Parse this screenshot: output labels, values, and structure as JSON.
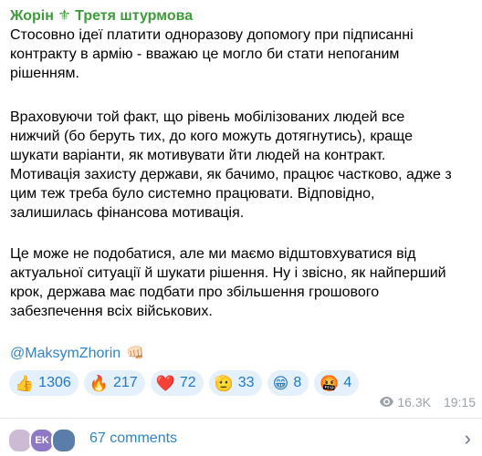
{
  "channel": {
    "name": "Жорін",
    "separator": "⚜",
    "subtitle": "Третя штурмова"
  },
  "post": {
    "paragraph1": "Стосовно ідеї платити одноразову допомогу при підписанні\nконтракту в армію - вважаю це могло би стати непоганим\nрішенням.",
    "paragraph2": "Враховуючи той факт, що рівень мобілізованих людей все\nнижчий (бо беруть тих, до кого можуть дотягнутись), краще\nшукати варіанти, як мотивувати йти людей на контракт.\nМотивація захисту держави, як бачимо, працює частково, адже з\nцим теж треба було системно працювати. Відповідно,\nзалишилась фінансова мотивація.",
    "paragraph3": "Це може не подобатися, але ми маємо відштовхуватися від\nактуальної ситуації й шукати рішення. Ну і звісно, як найперший\nкрок, держава має подбати про збільшення грошового\nзабезпечення всіх військових.",
    "mention": "@MaksymZhorin",
    "mention_emoji": "👊🏻"
  },
  "reactions": [
    {
      "emoji": "👍",
      "count": "1306"
    },
    {
      "emoji": "🔥",
      "count": "217"
    },
    {
      "emoji": "❤️",
      "count": "72"
    },
    {
      "emoji": "🫡",
      "count": "33"
    },
    {
      "emoji": "😁",
      "count": "8"
    },
    {
      "emoji": "🤬",
      "count": "4"
    }
  ],
  "meta": {
    "views": "16.3K",
    "time": "19:15"
  },
  "comments": {
    "avatar2_initials": "EK",
    "label": "67 comments"
  }
}
